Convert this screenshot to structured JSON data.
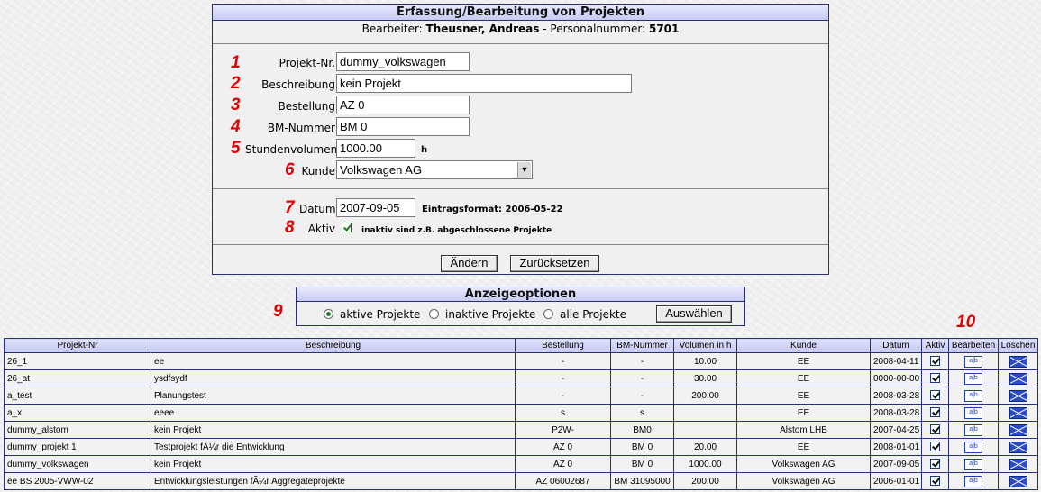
{
  "form": {
    "title": "Erfassung/Bearbeitung von Projekten",
    "editor_label": "Bearbeiter:",
    "editor_name": "Theusner, Andreas",
    "separator": "-",
    "personnel_label": "Personalnummer:",
    "personnel_number": "5701",
    "fields": {
      "projekt_nr": {
        "marker": "1",
        "label": "Projekt-Nr.",
        "value": "dummy_volkswagen"
      },
      "beschreibung": {
        "marker": "2",
        "label": "Beschreibung",
        "value": "kein Projekt"
      },
      "bestellung": {
        "marker": "3",
        "label": "Bestellung",
        "value": "AZ 0"
      },
      "bm_nummer": {
        "marker": "4",
        "label": "BM-Nummer",
        "value": "BM 0"
      },
      "stundenvolumen": {
        "marker": "5",
        "label": "Stundenvolumen",
        "value": "1000.00",
        "unit": "h"
      },
      "kunde": {
        "marker": "6",
        "label": "Kunde",
        "value": "Volkswagen AG"
      },
      "datum": {
        "marker": "7",
        "label": "Datum",
        "value": "2007-09-05",
        "hint": "Eintragsformat: 2006-05-22"
      },
      "aktiv": {
        "marker": "8",
        "label": "Aktiv",
        "checked": true,
        "hint": "inaktiv sind z.B. abgeschlossene Projekte"
      }
    },
    "buttons": {
      "change": "Ändern",
      "reset": "Zurücksetzen"
    }
  },
  "display_options": {
    "marker": "9",
    "title": "Anzeigeoptionen",
    "options": [
      {
        "label": "aktive Projekte",
        "selected": true
      },
      {
        "label": "inaktive Projekte",
        "selected": false
      },
      {
        "label": "alle Projekte",
        "selected": false
      }
    ],
    "button": "Auswählen"
  },
  "table": {
    "marker": "10",
    "columns": [
      "Projekt-Nr",
      "Beschreibung",
      "Bestellung",
      "BM-Nummer",
      "Volumen in h",
      "Kunde",
      "Datum",
      "Aktiv",
      "Bearbeiten",
      "Löschen"
    ],
    "edit_icon_text": "a|b",
    "rows": [
      {
        "nr": "26_1",
        "beschreibung": "ee",
        "bestellung": "-",
        "bm": "-",
        "volumen": "10.00",
        "kunde": "EE",
        "datum": "2008-04-11",
        "aktiv": true
      },
      {
        "nr": "26_at",
        "beschreibung": "ysdfsydf",
        "bestellung": "-",
        "bm": "-",
        "volumen": "30.00",
        "kunde": "EE",
        "datum": "0000-00-00",
        "aktiv": true
      },
      {
        "nr": "a_test",
        "beschreibung": "Planungstest",
        "bestellung": "-",
        "bm": "-",
        "volumen": "200.00",
        "kunde": "EE",
        "datum": "2008-03-28",
        "aktiv": true
      },
      {
        "nr": "a_x",
        "beschreibung": "eeee",
        "bestellung": "s",
        "bm": "s",
        "volumen": "",
        "kunde": "EE",
        "datum": "2008-03-28",
        "aktiv": true
      },
      {
        "nr": "dummy_alstom",
        "beschreibung": "kein Projekt",
        "bestellung": "P2W-",
        "bm": "BM0",
        "volumen": "",
        "kunde": "Alstom LHB",
        "datum": "2007-04-25",
        "aktiv": true
      },
      {
        "nr": "dummy_projekt 1",
        "beschreibung": "Testprojekt fÃ¼r die Entwicklung",
        "bestellung": "AZ 0",
        "bm": "BM 0",
        "volumen": "20.00",
        "kunde": "EE",
        "datum": "2008-01-01",
        "aktiv": true
      },
      {
        "nr": "dummy_volkswagen",
        "beschreibung": "kein Projekt",
        "bestellung": "AZ 0",
        "bm": "BM 0",
        "volumen": "1000.00",
        "kunde": "Volkswagen AG",
        "datum": "2007-09-05",
        "aktiv": true
      },
      {
        "nr": "ee BS 2005-VWW-02",
        "beschreibung": "Entwicklungsleistungen fÃ¼r Aggregateprojekte",
        "bestellung": "AZ 06002687",
        "bm": "BM 31095000",
        "volumen": "200.00",
        "kunde": "Volkswagen AG",
        "datum": "2006-01-01",
        "aktiv": true
      }
    ]
  }
}
